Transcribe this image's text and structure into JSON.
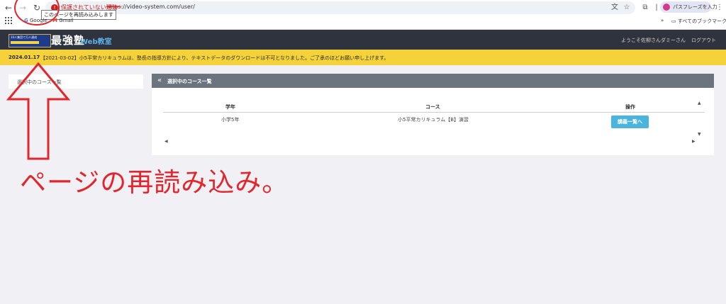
{
  "browser": {
    "security_warning": "保護されていない通信",
    "url_scheme": "https",
    "url_rest": "://video-system.com/user/",
    "reload_tooltip": "このページを再読み込みします",
    "profile_label": "パスフレーズを入力",
    "bookmarks": [
      "Google",
      "Gmail"
    ],
    "all_bookmarks": "すべてのブックマーク"
  },
  "site": {
    "logo_small_text": "10人集団で万人達成",
    "logo_name": "最強塾",
    "section_title": "Web教室",
    "welcome": "ようこそ佐柳さんダミーさん",
    "logout": "ログアウト"
  },
  "notice": {
    "date": "2024.01.17",
    "text": "【2021-03-02】小5平常カリキュラムは、塾長の指導方針により、テキストデータのダウンロードは不可となりました。ご了承のほどお願い申し上げます。"
  },
  "sidebar": {
    "items": [
      {
        "label": "選択中のコース一覧"
      }
    ]
  },
  "panel": {
    "title": "選択中のコース一覧",
    "columns": [
      "学年",
      "コース",
      "操作"
    ],
    "rows": [
      {
        "grade": "小学5年",
        "course": "小5平常カリキュラム【B】演習",
        "action": "講義一覧へ"
      }
    ]
  },
  "annotation": {
    "caption": "ページの再読み込み。"
  },
  "colors": {
    "accent_red": "#e2262d",
    "header_bg": "#2f333d",
    "notice_bg": "#f5d23a",
    "button_blue": "#4bb4de"
  }
}
